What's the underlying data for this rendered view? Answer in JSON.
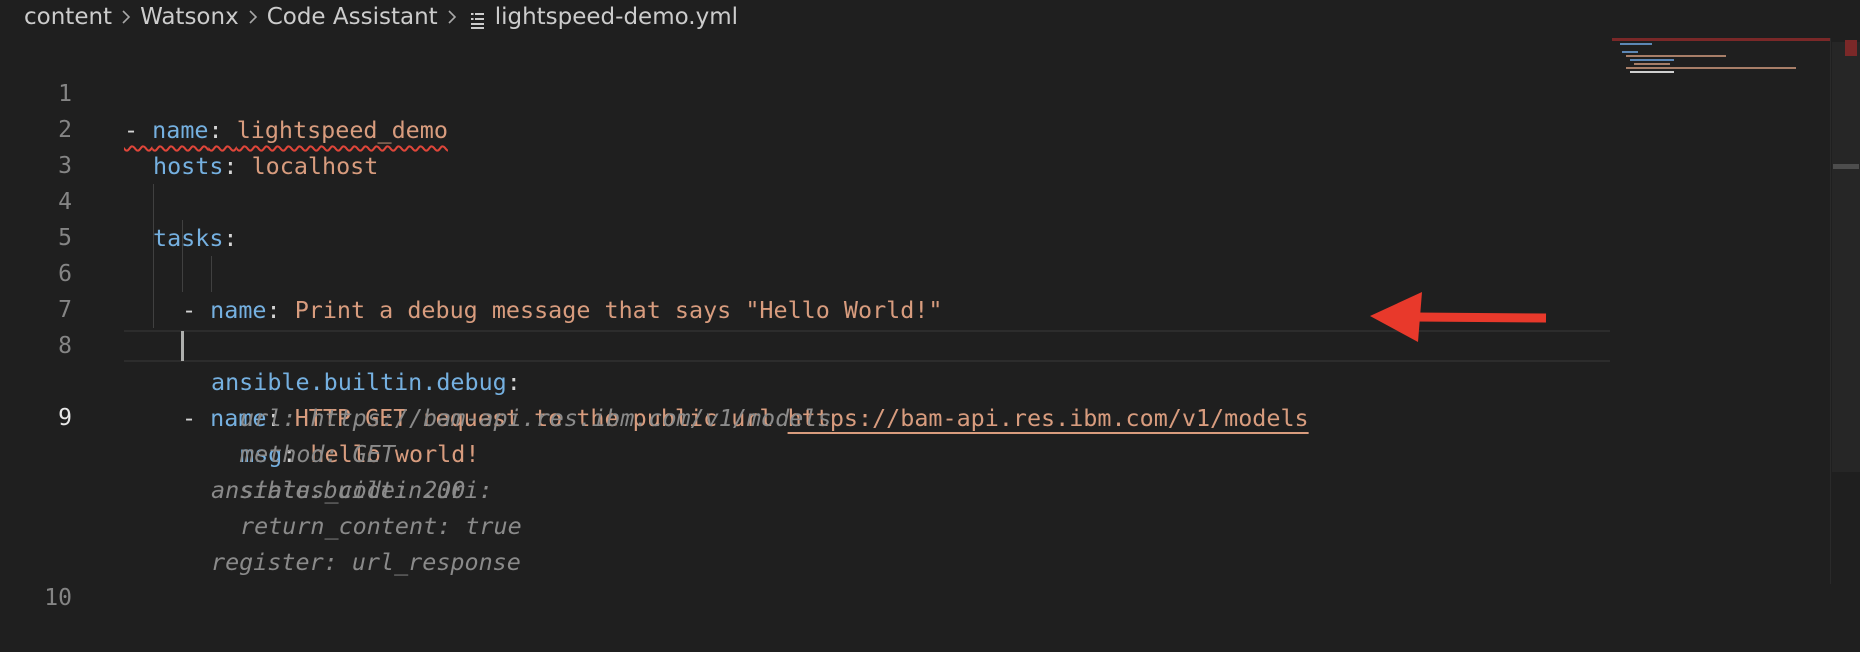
{
  "breadcrumb": {
    "items": [
      "content",
      "Watsonx",
      "Code Assistant"
    ],
    "file": "lightspeed-demo.yml"
  },
  "editor": {
    "line_numbers": [
      "1",
      "2",
      "3",
      "4",
      "5",
      "6",
      "7",
      "8",
      "9",
      "10"
    ],
    "active_line": "9",
    "lines": {
      "l1": {
        "dash": "- ",
        "key": "name",
        "colon": ": ",
        "value": "lightspeed_demo"
      },
      "l2": {
        "key": "hosts",
        "colon": ": ",
        "value": "localhost"
      },
      "l4": {
        "key": "tasks",
        "colon": ":"
      },
      "l5": {
        "dash": "- ",
        "key": "name",
        "colon": ": ",
        "value": "Print a debug message that says \"Hello World!\""
      },
      "l6": {
        "key": "ansible.builtin.debug",
        "colon": ":"
      },
      "l7": {
        "key": "msg",
        "colon": ": ",
        "value": "hello world!"
      },
      "l8": {
        "dash": "- ",
        "key": "name",
        "colon": ": ",
        "value": "HTTP GET request to the public url ",
        "url": "https://bam-api.res.ibm.com/v1/models"
      }
    },
    "suggestion": {
      "s1": "ansible.builtin.uri:",
      "s2": "url: https://bam-api.res.ibm.com/v1/models",
      "s3": "method: GET",
      "s4": "status_code: 200",
      "s5": "return_content: true",
      "s6": "register: url_response"
    }
  },
  "colors": {
    "background": "#1f1f1f",
    "key": "#75b0e0",
    "string": "#d89c7e",
    "ghost_text": "#8a8a8a",
    "arrow": "#e8392b",
    "error_squiggle": "#e0463a"
  },
  "icons": {
    "file": "file-lines-icon",
    "breadcrumb_separator": "chevron-right-icon",
    "annotation": "red-arrow-icon"
  }
}
